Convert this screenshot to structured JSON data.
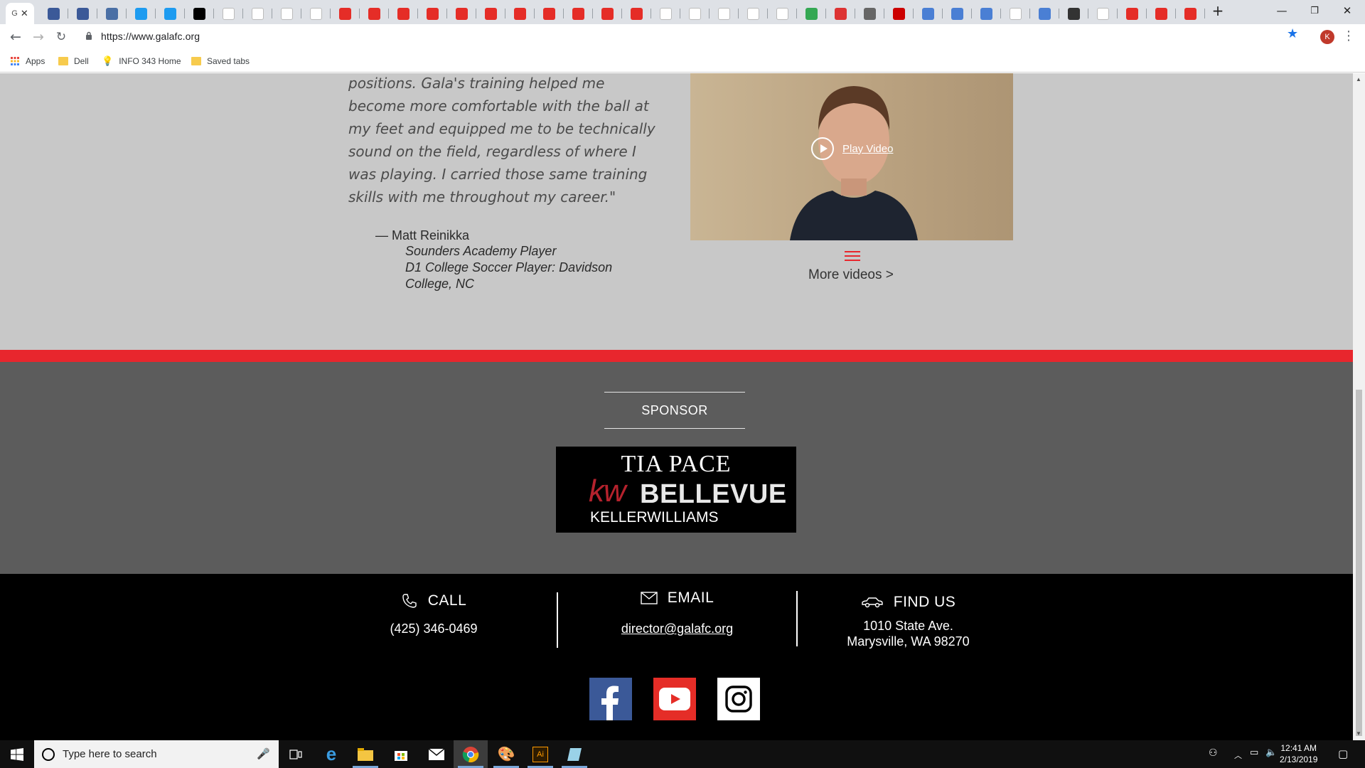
{
  "browser": {
    "url": "https://www.galafc.org",
    "profile_initial": "K",
    "new_tab": "+",
    "bookmarks": [
      {
        "label": "Apps"
      },
      {
        "label": "Dell"
      },
      {
        "label": "INFO 343 Home"
      },
      {
        "label": "Saved tabs"
      }
    ]
  },
  "testimonial": {
    "quote": "positions. Gala's training helped me become more comfortable with the ball at my feet and equipped me to be technically sound on the field, regardless of where I was playing. I carried those same training skills with me throughout my career.\"",
    "name": "— Matt Reinikka",
    "role1": "Sounders Academy Player",
    "role2": "D1 College Soccer Player: Davidson College, NC",
    "play_label": "Play Video",
    "more_videos": "More videos >"
  },
  "sponsor": {
    "title": "SPONSOR",
    "logo_line1": "TIA PACE",
    "logo_kw": "kw",
    "logo_city": "BELLEVUE",
    "logo_line3": "KELLERWILLIAMS"
  },
  "footer": {
    "call_label": "CALL",
    "call_value": "(425) 346-0469",
    "email_label": "EMAIL",
    "email_value": "director@galafc.org",
    "find_label": "FIND US",
    "address1": "1010 State Ave.",
    "address2": "Marysville, WA 98270"
  },
  "taskbar": {
    "search_placeholder": "Type here to search",
    "time": "12:41 AM",
    "date": "2/13/2019"
  },
  "colors": {
    "accent_red": "#e8262d",
    "sponsor_bg": "#5c5c5c",
    "testimonial_bg": "#c8c8c8"
  }
}
